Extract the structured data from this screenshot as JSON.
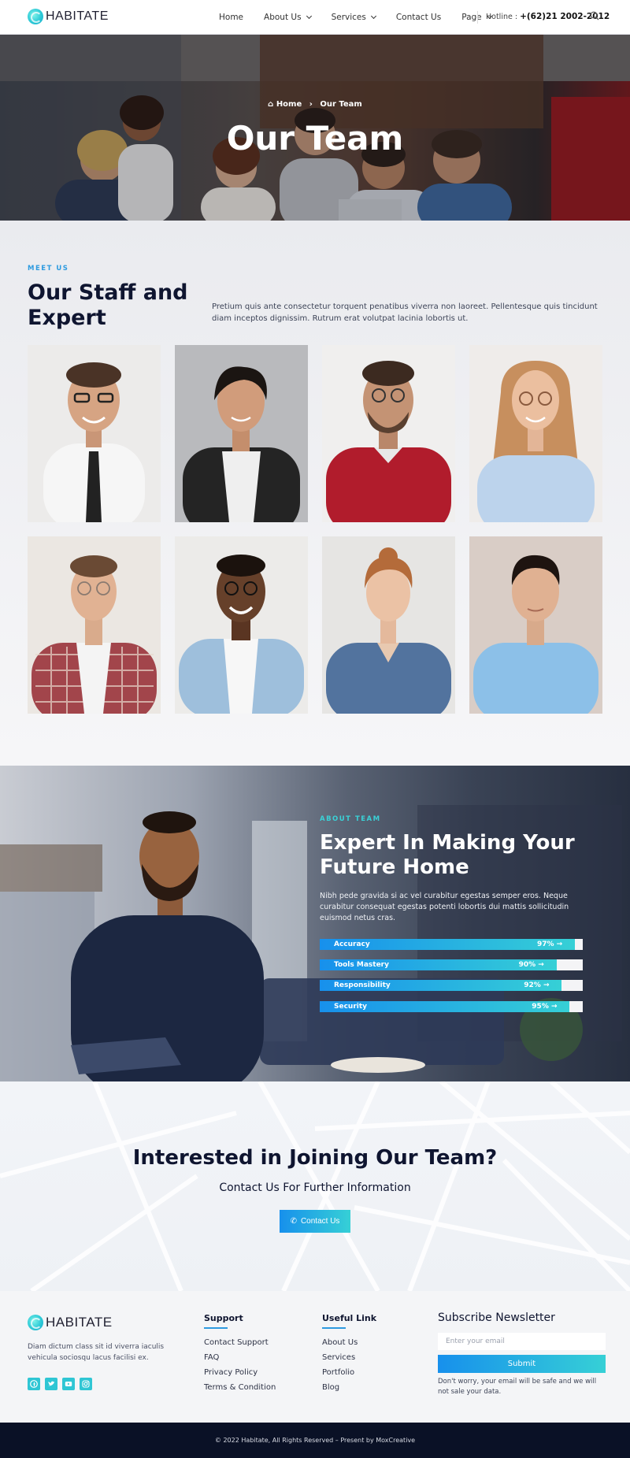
{
  "nav": {
    "logo": "HABITATE",
    "menu": [
      {
        "label": "Home",
        "dropdown": false
      },
      {
        "label": "About Us",
        "dropdown": true
      },
      {
        "label": "Services",
        "dropdown": true
      },
      {
        "label": "Contact Us",
        "dropdown": false
      },
      {
        "label": "Page",
        "dropdown": true
      }
    ],
    "hotline_label": "Hotline :",
    "hotline_number": "+(62)21 2002-2012",
    "search_icon": "search-icon"
  },
  "hero": {
    "crumb_home": "Home",
    "crumb_current": "Our Team",
    "title": "Our Team"
  },
  "team": {
    "eyebrow": "MEET US",
    "title": "Our Staff and Expert",
    "description": "Pretium quis ante consectetur torquent penatibus viverra non laoreet. Pellentesque quis tincidunt diam inceptos dignissim. Rutrum erat volutpat lacinia lobortis ut."
  },
  "about": {
    "eyebrow": "ABOUT TEAM",
    "title": "Expert In Making Your Future Home",
    "description": "Nibh pede gravida si ac vel curabitur egestas semper eros. Neque curabitur consequat egestas potenti lobortis dui mattis sollicitudin euismod netus cras.",
    "skills": [
      {
        "name": "Accuracy",
        "value": 97,
        "label": "97%"
      },
      {
        "name": "Tools Mastery",
        "value": 90,
        "label": "90%"
      },
      {
        "name": "Responsibility",
        "value": 92,
        "label": "92%"
      },
      {
        "name": "Security",
        "value": 95,
        "label": "95%"
      }
    ]
  },
  "join": {
    "title": "Interested in Joining Our Team?",
    "subtitle": "Contact Us For Further Information",
    "button": "Contact Us"
  },
  "footer": {
    "logo": "HABITATE",
    "description": "Diam dictum class sit id viverra iaculis vehicula sociosqu lacus facilisi ex.",
    "socials": [
      "facebook-icon",
      "twitter-icon",
      "youtube-icon",
      "instagram-icon"
    ],
    "support": {
      "title": "Support",
      "links": [
        "Contact Support",
        "FAQ",
        "Privacy Policy",
        "Terms & Condition"
      ]
    },
    "useful": {
      "title": "Useful Link",
      "links": [
        "About Us",
        "Services",
        "Portfolio",
        "Blog"
      ]
    },
    "newsletter": {
      "title": "Subscribe Newsletter",
      "placeholder": "Enter your email",
      "button": "Submit",
      "note": "Don't worry, your email will be safe and we will not sale your data."
    },
    "copyright": "© 2022 Habitate, All Rights Reserved – Present by MoxCreative"
  },
  "colors": {
    "accent": "#2e9be0",
    "gradient_start": "#1790ec",
    "gradient_end": "#36d0d6",
    "dark": "#0a1126"
  }
}
